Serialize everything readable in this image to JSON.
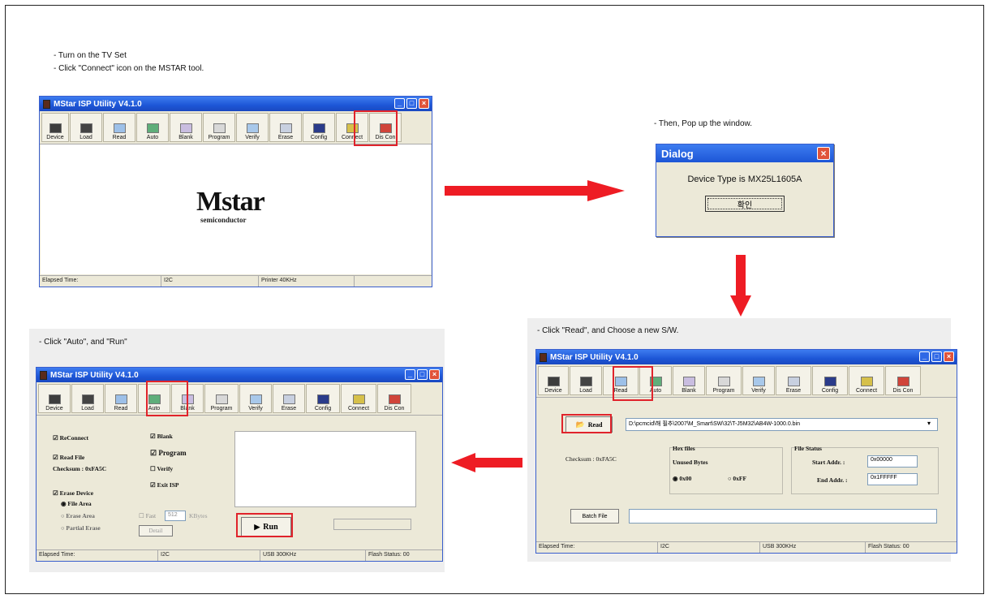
{
  "instructions": {
    "step1_line1": "- Turn on the TV Set",
    "step1_line2": "- Click \"Connect\" icon on the MSTAR tool.",
    "step2": "- Then, Pop up the window.",
    "step3": "- Click \"Read\", and Choose a new S/W.",
    "step4": "- Click \"Auto\", and \"Run\""
  },
  "app": {
    "title": "MStar ISP Utility V4.1.0",
    "toolbar": [
      "Device",
      "Load",
      "Read",
      "Auto",
      "Blank",
      "Program",
      "Verify",
      "Erase",
      "Config",
      "Connect",
      "Dis Con"
    ],
    "logo_main": "Mstar",
    "logo_sub": "semiconductor"
  },
  "status_win1": {
    "elapsed": "Elapsed Time:",
    "bus": "I2C",
    "speed": "Printer 40KHz"
  },
  "dialog": {
    "title": "Dialog",
    "message": "Device Type is MX25L1605A",
    "ok": "확인"
  },
  "read_win": {
    "read_button": "Read",
    "path": "D:\\pcmcid\\해 필추\\2007\\M_Smart\\SW\\32\\T-J5M32\\AB4W-1000.0.bin",
    "checksum": "Checksum : 0xFA5C",
    "hex_files": "Hex files",
    "unused_bytes": "Unused Bytes",
    "opt_00": "0x00",
    "opt_ff": "0xFF",
    "file_status": "File Status",
    "start_label": "Start Addr. :",
    "start_value": "0x00000",
    "end_label": "End Addr. :",
    "end_value": "0x1FFFFF",
    "batch_file": "Batch File",
    "status": {
      "elapsed": "Elapsed Time:",
      "bus": "I2C",
      "speed": "USB 300KHz",
      "flash": "Flash Status: 00"
    }
  },
  "auto_win": {
    "reconnect": "ReConnect",
    "read_file": "Read File",
    "checksum": "Checksum : 0xFA5C",
    "erase_device": "Erase Device",
    "file_area": "File Area",
    "erase_area": "Erase Area",
    "partial_erase": "Partial Erase",
    "fast": "Fast",
    "fast_value": "512",
    "kbytes": "KBytes",
    "detail": "Detail",
    "blank": "Blank",
    "program": "Program",
    "verify": "Verify",
    "exit_isp": "Exit ISP",
    "run": "Run",
    "status": {
      "elapsed": "Elapsed Time:",
      "bus": "I2C",
      "speed": "USB 300KHz",
      "flash": "Flash Status: 00"
    }
  },
  "colors": {
    "highlight": "#e0232b",
    "arrow": "#ee1c24",
    "titlebar": "#1d56d6"
  }
}
